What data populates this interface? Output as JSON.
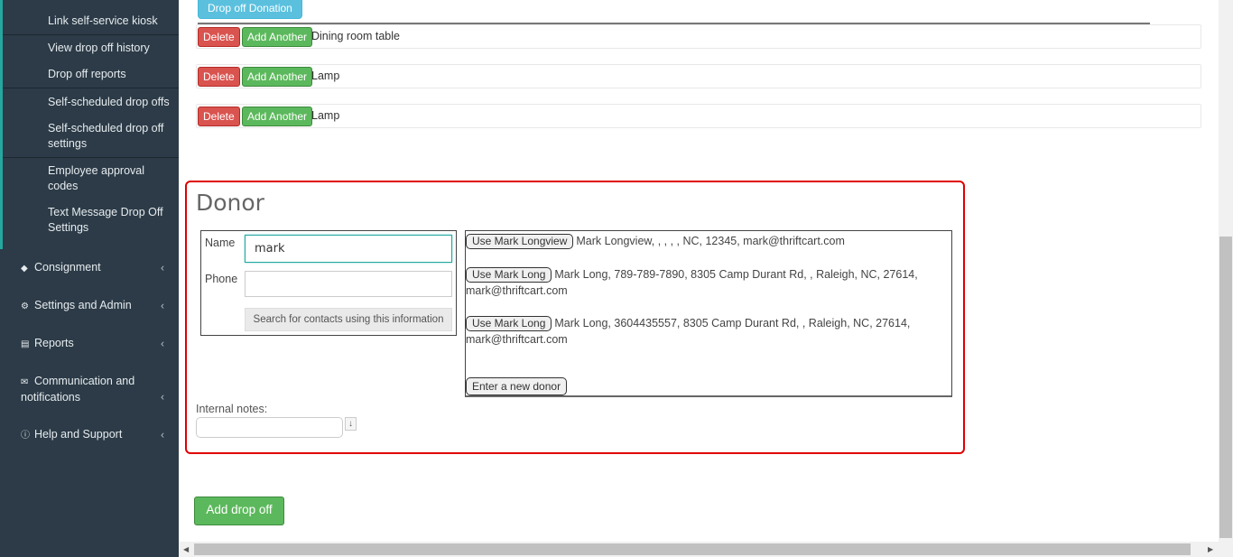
{
  "sidebar": {
    "sub_items": [
      {
        "label": "Link self-service kiosk"
      },
      {
        "label": "View drop off history"
      },
      {
        "label": "Drop off reports"
      },
      {
        "label": "Self-scheduled drop offs"
      },
      {
        "label": "Self-scheduled drop off settings"
      },
      {
        "label": "Employee approval codes"
      },
      {
        "label": "Text Message Drop Off Settings"
      }
    ],
    "nav_items": [
      {
        "label": "Consignment",
        "icon": "tag-icon"
      },
      {
        "label": "Settings and Admin",
        "icon": "gear-icon"
      },
      {
        "label": "Reports",
        "icon": "bar-chart-icon"
      },
      {
        "label": "Communication and notifications",
        "icon": "envelope-icon"
      },
      {
        "label": "Help and Support",
        "icon": "question-circle-icon"
      }
    ]
  },
  "main": {
    "dropoff_button": "Drop off Donation",
    "items": [
      {
        "delete_label": "Delete",
        "add_label": "Add Another",
        "name": "Dining room table"
      },
      {
        "delete_label": "Delete",
        "add_label": "Add Another",
        "name": "Lamp"
      },
      {
        "delete_label": "Delete",
        "add_label": "Add Another",
        "name": "Lamp"
      }
    ],
    "donor": {
      "title": "Donor",
      "name_label": "Name",
      "name_value": "mark",
      "phone_label": "Phone",
      "phone_value": "",
      "search_button": "Search for contacts using this information",
      "results": [
        {
          "button": "Use Mark Longview",
          "text": "Mark Longview, , , , , NC, 12345, mark@thriftcart.com"
        },
        {
          "button": "Use Mark Long",
          "text": "Mark Long, 789-789-7890, 8305 Camp Durant Rd, , Raleigh, NC, 27614, mark@thriftcart.com"
        },
        {
          "button": "Use Mark Long",
          "text": "Mark Long, 3604435557, 8305 Camp Durant Rd, , Raleigh, NC, 27614, mark@thriftcart.com"
        }
      ],
      "new_donor_button": "Enter a new donor",
      "notes_label": "Internal notes:",
      "notes_toggle": "↓"
    },
    "add_dropoff_button": "Add drop off"
  },
  "colors": {
    "sidebar_bg": "#2c3b47",
    "accent": "#25a7a0",
    "highlight_border": "#e00000",
    "success": "#5cb85c",
    "danger": "#d9534f",
    "info": "#5bc0de"
  }
}
